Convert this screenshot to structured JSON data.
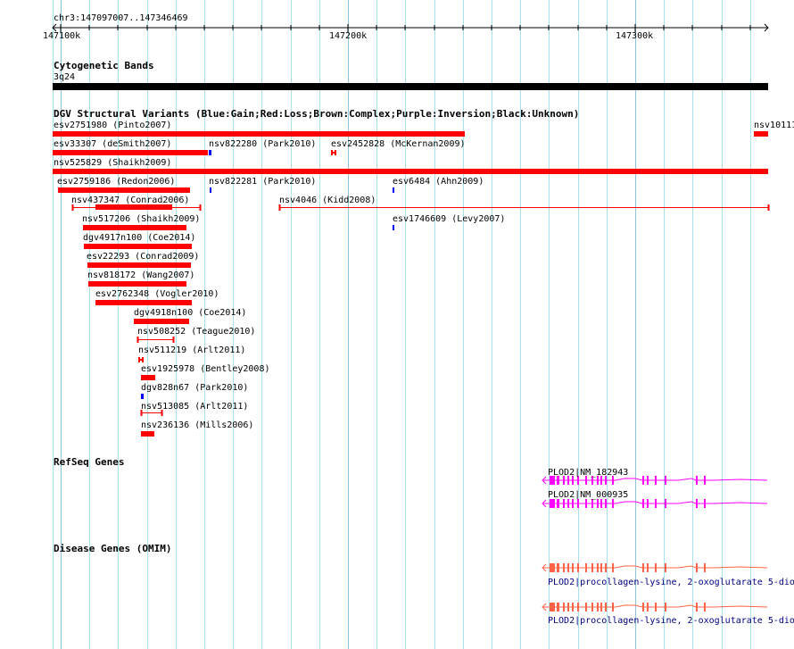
{
  "ruler": {
    "region": "chr3:147097007..147346469",
    "ticks": [
      "147100k",
      "147200k",
      "147300k"
    ]
  },
  "cytoband": {
    "title": "Cytogenetic Bands",
    "band": "3q24"
  },
  "dgv": {
    "title": "DGV Structural Variants (Blue:Gain;Red:Loss;Brown:Complex;Purple:Inversion;Black:Unknown)",
    "features": [
      {
        "label": "esv2751980 (Pinto2007)",
        "type": "loss"
      },
      {
        "label": "nsv10111",
        "type": "loss"
      },
      {
        "label": "esv33307 (deSmith2007)",
        "type": "loss"
      },
      {
        "label": "nsv822280 (Park2010)",
        "type": "gain"
      },
      {
        "label": "esv2452828 (McKernan2009)",
        "type": "loss"
      },
      {
        "label": "nsv525829 (Shaikh2009)",
        "type": "loss"
      },
      {
        "label": "esv2759186 (Redon2006)",
        "type": "loss"
      },
      {
        "label": "nsv822281 (Park2010)",
        "type": "gain"
      },
      {
        "label": "esv6484 (Ahn2009)",
        "type": "gain"
      },
      {
        "label": "nsv437347 (Conrad2006)",
        "type": "loss"
      },
      {
        "label": "nsv4046 (Kidd2008)",
        "type": "loss"
      },
      {
        "label": "nsv517206 (Shaikh2009)",
        "type": "loss"
      },
      {
        "label": "esv1746609 (Levy2007)",
        "type": "gain"
      },
      {
        "label": "dgv4917n100 (Coe2014)",
        "type": "loss"
      },
      {
        "label": "esv22293 (Conrad2009)",
        "type": "loss"
      },
      {
        "label": "nsv818172 (Wang2007)",
        "type": "loss"
      },
      {
        "label": "esv2762348 (Vogler2010)",
        "type": "loss"
      },
      {
        "label": "dgv4918n100 (Coe2014)",
        "type": "loss"
      },
      {
        "label": "nsv508252 (Teague2010)",
        "type": "loss"
      },
      {
        "label": "nsv511219 (Arlt2011)",
        "type": "loss"
      },
      {
        "label": "esv1925978 (Bentley2008)",
        "type": "loss"
      },
      {
        "label": "dgv828n67 (Park2010)",
        "type": "gain"
      },
      {
        "label": "nsv513085 (Arlt2011)",
        "type": "loss"
      },
      {
        "label": "nsv236136 (Mills2006)",
        "type": "loss"
      }
    ]
  },
  "refseq": {
    "title": "RefSeq Genes",
    "transcripts": [
      "PLOD2|NM_182943",
      "PLOD2|NM_000935"
    ]
  },
  "omim": {
    "title": "Disease Genes (OMIM)",
    "entries": [
      "PLOD2|procollagen-lysine, 2-oxoglutarate 5-dio",
      "PLOD2|procollagen-lysine, 2-oxoglutarate 5-dio"
    ]
  },
  "colors": {
    "loss": "#ff0000",
    "gain": "#0000ff",
    "refseq": "#ff00ff",
    "omim": "#ff6347",
    "omim_text": "#000080",
    "grid": "#a9e3ea"
  }
}
